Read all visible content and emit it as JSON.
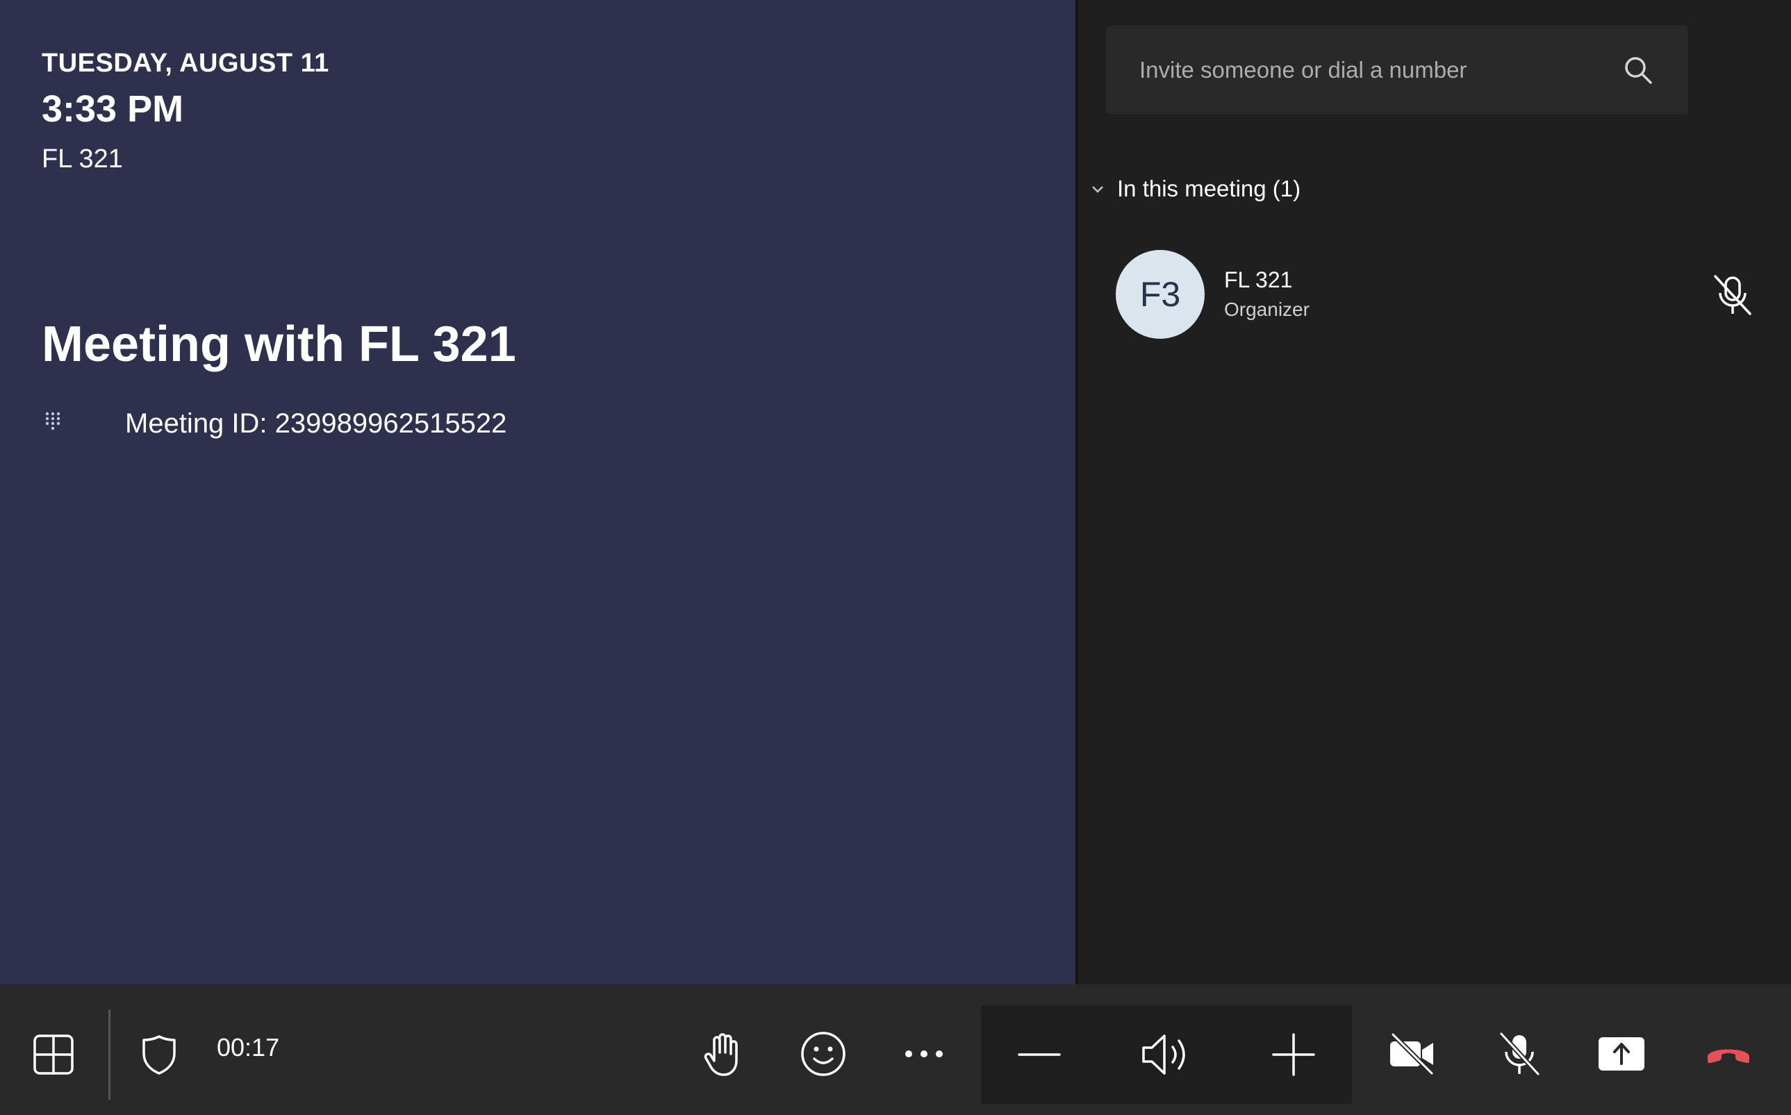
{
  "stage": {
    "date": "TUESDAY, AUGUST 11",
    "time": "3:33 PM",
    "organizer": "FL 321",
    "meeting_title": "Meeting with FL 321",
    "meeting_id": "Meeting ID: 239989962515522"
  },
  "panel": {
    "search": {
      "placeholder": "Invite someone or dial a number",
      "value": ""
    },
    "section_label": "In this meeting (1)",
    "participants": [
      {
        "initials": "F3",
        "name": "FL 321",
        "role": "Organizer",
        "mic_icon": "mic-off-icon"
      }
    ]
  },
  "toolbar": {
    "timer": "00:17",
    "icons": [
      "layout-grid-icon",
      "shield-icon",
      "raise-hand-icon",
      "emoji-icon",
      "more-options-icon",
      "volume-down-icon",
      "speaker-icon",
      "volume-up-icon",
      "camera-off-icon",
      "mic-off-icon",
      "share-tray-icon",
      "hang-up-icon"
    ]
  },
  "colors": {
    "stage_bg": "#2f304e",
    "panel_bg": "#1f1f1f",
    "toolbar_bg": "#292929",
    "search_bg": "#292929",
    "avatar_bg": "#dbe5ee",
    "avatar_text": "#26324a",
    "hang_up": "#e4515a"
  }
}
